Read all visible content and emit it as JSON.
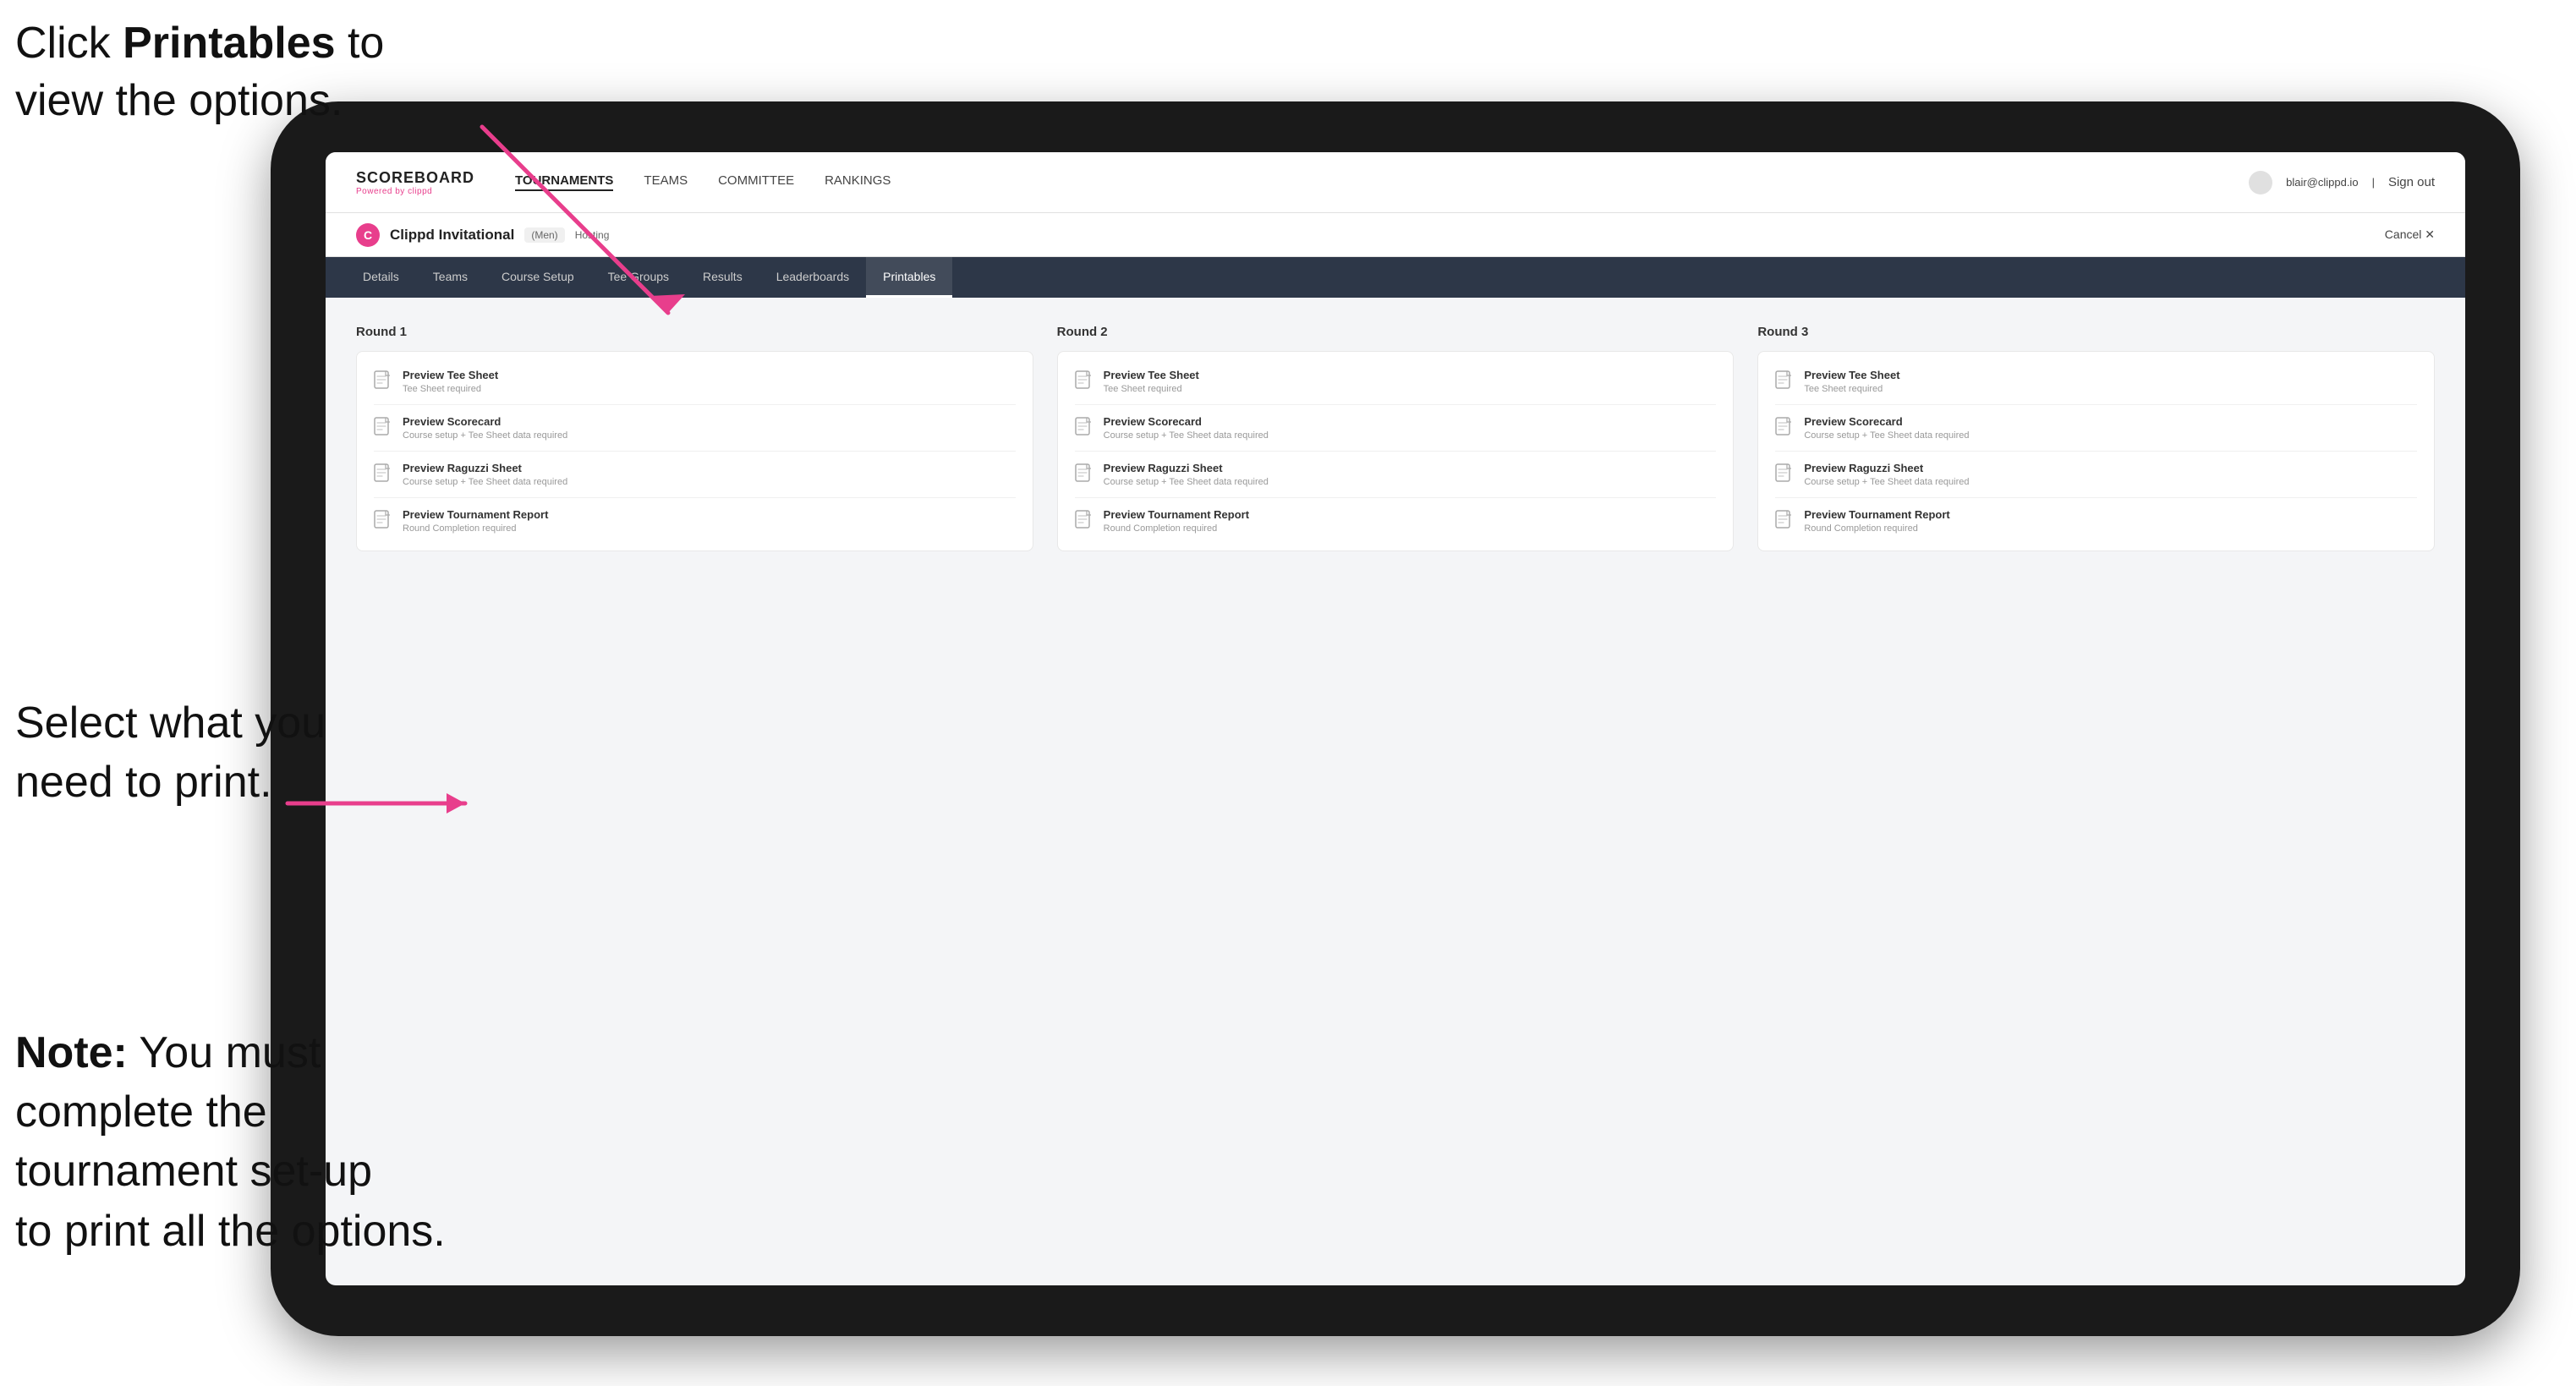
{
  "annotations": {
    "top": {
      "line1": "Click ",
      "bold": "Printables",
      "line2": " to",
      "line3": "view the options."
    },
    "mid": {
      "line1": "Select what you",
      "line2": "need to print."
    },
    "bot": {
      "line1": "Note:",
      "note_rest": " You must",
      "line2": "complete the",
      "line3": "tournament set-up",
      "line4": "to print all the options."
    }
  },
  "nav": {
    "logo_title": "SCOREBOARD",
    "logo_sub": "Powered by clippd",
    "links": [
      "TOURNAMENTS",
      "TEAMS",
      "COMMITTEE",
      "RANKINGS"
    ],
    "user_email": "blair@clippd.io",
    "sign_out": "Sign out"
  },
  "sub_header": {
    "tournament_name": "Clippd Invitational",
    "badge": "(Men)",
    "hosting": "Hosting",
    "cancel": "Cancel ✕"
  },
  "tabs": {
    "items": [
      "Details",
      "Teams",
      "Course Setup",
      "Tee Groups",
      "Results",
      "Leaderboards",
      "Printables"
    ],
    "active": "Printables"
  },
  "rounds": [
    {
      "title": "Round 1",
      "items": [
        {
          "title": "Preview Tee Sheet",
          "sub": "Tee Sheet required"
        },
        {
          "title": "Preview Scorecard",
          "sub": "Course setup + Tee Sheet data required"
        },
        {
          "title": "Preview Raguzzi Sheet",
          "sub": "Course setup + Tee Sheet data required"
        },
        {
          "title": "Preview Tournament Report",
          "sub": "Round Completion required"
        }
      ]
    },
    {
      "title": "Round 2",
      "items": [
        {
          "title": "Preview Tee Sheet",
          "sub": "Tee Sheet required"
        },
        {
          "title": "Preview Scorecard",
          "sub": "Course setup + Tee Sheet data required"
        },
        {
          "title": "Preview Raguzzi Sheet",
          "sub": "Course setup + Tee Sheet data required"
        },
        {
          "title": "Preview Tournament Report",
          "sub": "Round Completion required"
        }
      ]
    },
    {
      "title": "Round 3",
      "items": [
        {
          "title": "Preview Tee Sheet",
          "sub": "Tee Sheet required"
        },
        {
          "title": "Preview Scorecard",
          "sub": "Course setup + Tee Sheet data required"
        },
        {
          "title": "Preview Raguzzi Sheet",
          "sub": "Course setup + Tee Sheet data required"
        },
        {
          "title": "Preview Tournament Report",
          "sub": "Round Completion required"
        }
      ]
    }
  ],
  "colors": {
    "accent": "#e83e8c",
    "arrow": "#e83e8c",
    "nav_bg": "#2d3748"
  }
}
